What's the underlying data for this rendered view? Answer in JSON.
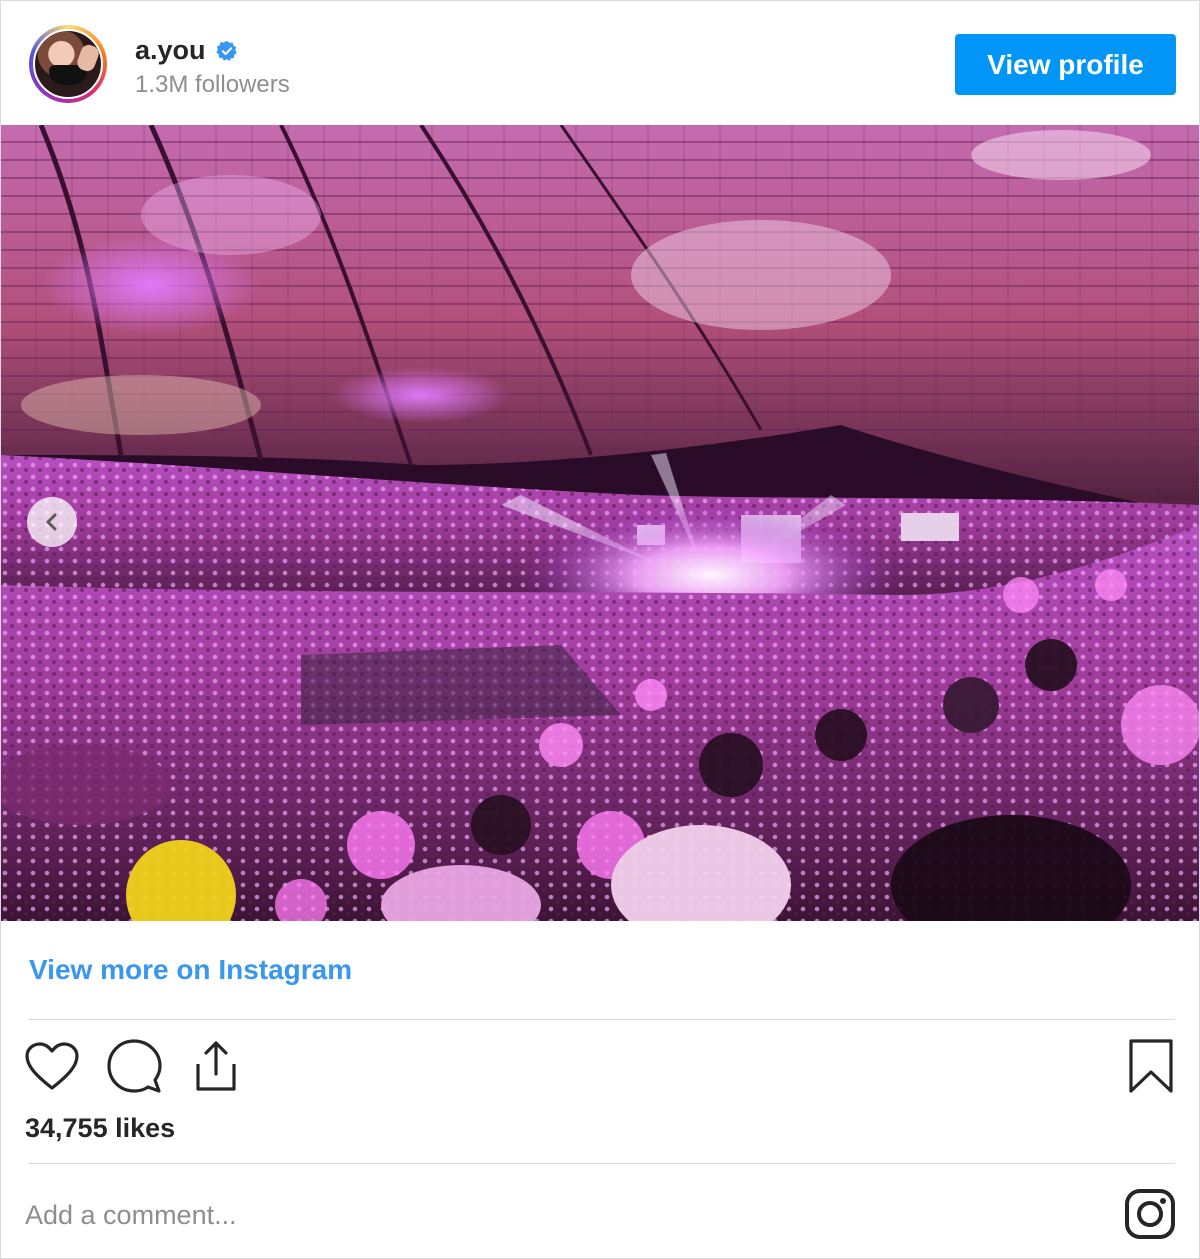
{
  "header": {
    "username": "a.you",
    "followers": "1.3M followers",
    "view_profile_label": "View profile",
    "verified_icon": "verified-badge-icon",
    "verified_color": "#3897f0"
  },
  "post": {
    "image_description_icon": "concert-photo",
    "carousel_prev_icon": "chevron-left-icon"
  },
  "footer": {
    "view_more_label": "View more on Instagram",
    "likes": "34,755 likes",
    "comment_placeholder": "Add a comment...",
    "action_icons": [
      "heart-icon",
      "comment-icon",
      "share-icon"
    ],
    "bookmark_icon": "bookmark-icon",
    "brand_icon": "instagram-icon"
  },
  "colors": {
    "accent": "#0095f6",
    "link": "#3897f0",
    "muted": "#8e8e8e",
    "text": "#262626"
  }
}
